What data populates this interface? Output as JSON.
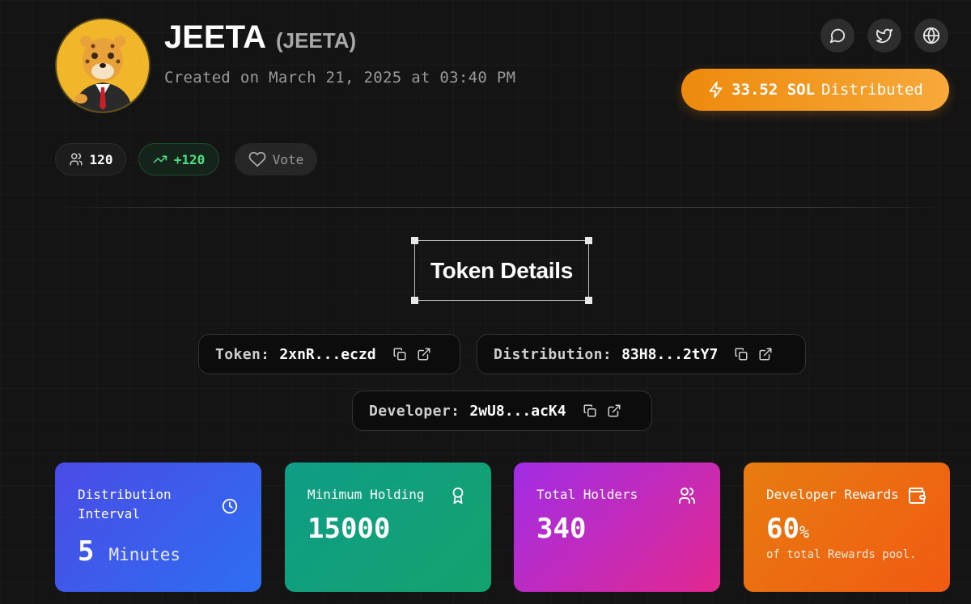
{
  "token": {
    "name": "JEETA",
    "ticker": "(JEETA)",
    "created": "Created on March 21, 2025 at 03:40 PM"
  },
  "social": {
    "chat": "chat-icon",
    "twitter": "twitter-icon",
    "website": "globe-icon"
  },
  "distributed": {
    "amount": "33.52 SOL",
    "label": "Distributed"
  },
  "stats": {
    "holders_count": "120",
    "trend": "+120",
    "vote_label": "Vote"
  },
  "section": {
    "title": "Token Details"
  },
  "addresses": [
    {
      "label": "Token:",
      "value": "2xnR...eczd"
    },
    {
      "label": "Distribution:",
      "value": "83H8...2tY7"
    },
    {
      "label": "Developer:",
      "value": "2wU8...acK4"
    }
  ],
  "cards": {
    "interval": {
      "label_line1": "Distribution",
      "label_line2": "Interval",
      "value": "5",
      "unit": "Minutes"
    },
    "min_holding": {
      "label": "Minimum Holding",
      "value": "15000"
    },
    "holders": {
      "label": "Total Holders",
      "value": "340"
    },
    "rewards": {
      "label": "Developer Rewards",
      "value": "60",
      "unit": "%",
      "caption": "of total Rewards pool."
    }
  },
  "colors": {
    "accent_orange": "#f19a1f",
    "trend_green": "#4ade80",
    "background": "#141414"
  }
}
